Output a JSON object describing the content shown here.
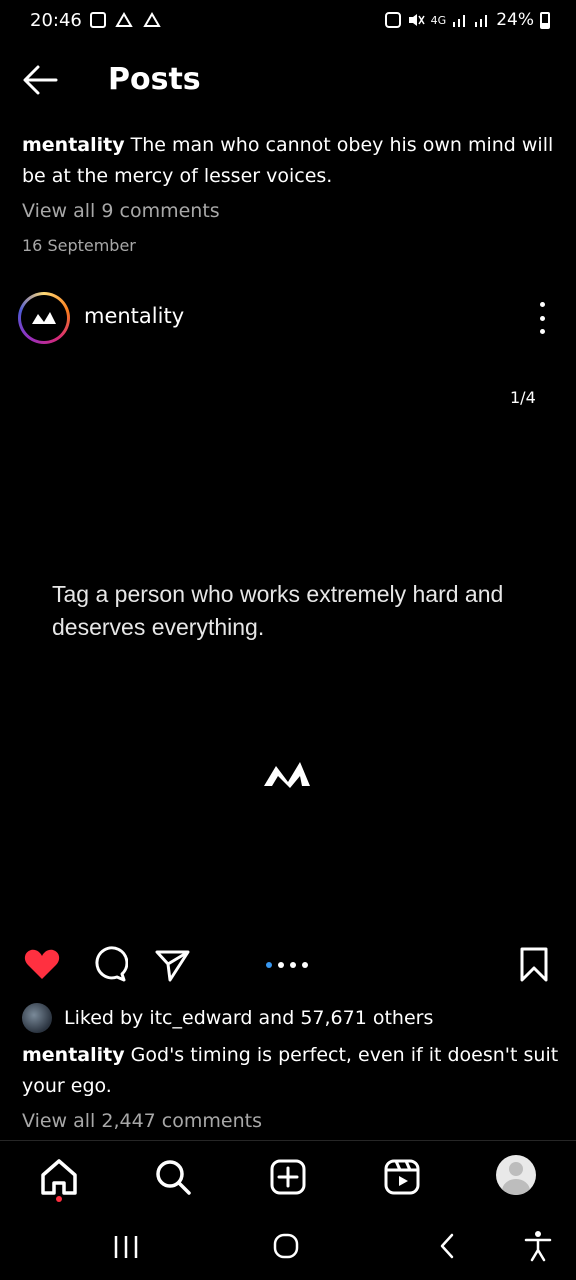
{
  "status_bar": {
    "time": "20:46",
    "network": "4G",
    "battery": "24%",
    "icons": [
      "gallery-icon",
      "cloud-icon",
      "cloud-icon",
      "battery-saver-icon",
      "mute-icon",
      "signal-icon",
      "signal-icon",
      "battery-icon"
    ]
  },
  "header": {
    "title": "Posts",
    "back_icon": "arrow-left-icon"
  },
  "previous_post": {
    "caption_user": "mentality",
    "caption_text": "The man who cannot obey his own mind will be at the mercy of lesser voices.",
    "view_comments": "View all 9 comments",
    "date": "16 September"
  },
  "post": {
    "username": "mentality",
    "counter": "1/4",
    "image_text": "Tag a person who works extremely hard and deserves everything.",
    "like_icon": "heart-icon",
    "comment_icon": "comment-icon",
    "share_icon": "send-icon",
    "save_icon": "bookmark-icon",
    "carousel_dots": 4,
    "carousel_active": 1,
    "liked_by_prefix": "Liked by ",
    "liked_by_user": "itc_edward",
    "liked_by_middle": " and ",
    "liked_by_count": "57,671 others",
    "caption_user": "mentality",
    "caption_text": "God's timing is perfect, even if it doesn't suit your ego.",
    "view_comments": "View all 2,447 comments"
  },
  "bottom_nav": {
    "items": [
      "home-icon",
      "search-icon",
      "create-icon",
      "reels-icon",
      "profile-icon"
    ]
  },
  "system_nav": {
    "items": [
      "recent-apps-icon",
      "home-button-icon",
      "back-button-icon",
      "accessibility-icon"
    ]
  },
  "colors": {
    "like": "#ff3040",
    "active_dot": "#3897f0",
    "muted": "#a8a8a8"
  }
}
